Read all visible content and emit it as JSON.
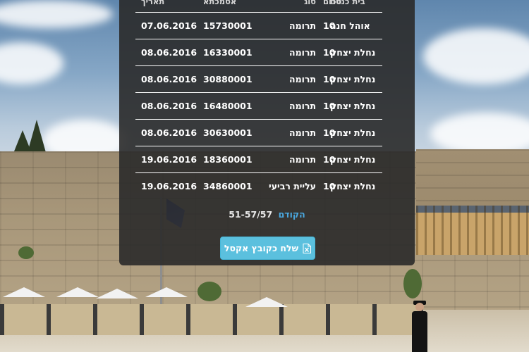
{
  "table": {
    "headers": {
      "date": "תאריך",
      "account": "אסמכתא",
      "type": "סוג",
      "amount": "סכום",
      "synagogue": "בית כנסת"
    },
    "rows": [
      {
        "date": "07.06.2016",
        "account": "15730001",
        "type": "תרומה",
        "amount": "10",
        "synagogue": "אוהל חנה"
      },
      {
        "date": "08.06.2016",
        "account": "16330001",
        "type": "תרומה",
        "amount": "10",
        "synagogue": "נחלת יצחק"
      },
      {
        "date": "08.06.2016",
        "account": "30880001",
        "type": "תרומה",
        "amount": "10",
        "synagogue": "נחלת יצחק"
      },
      {
        "date": "08.06.2016",
        "account": "16480001",
        "type": "תרומה",
        "amount": "10",
        "synagogue": "נחלת יצחק"
      },
      {
        "date": "08.06.2016",
        "account": "30630001",
        "type": "תרומה",
        "amount": "10",
        "synagogue": "נחלת יצחק"
      },
      {
        "date": "19.06.2016",
        "account": "18360001",
        "type": "תרומה",
        "amount": "10",
        "synagogue": "נחלת יצחק"
      },
      {
        "date": "19.06.2016",
        "account": "34860001",
        "type": "עליית רביעי",
        "amount": "10",
        "synagogue": "נחלת יצחק"
      }
    ]
  },
  "pager": {
    "range": "51-57/57",
    "prev_label": "הקודם"
  },
  "actions": {
    "excel_label": "שלח כקובץ אקסל",
    "excel_icon": "excel-file-icon"
  },
  "colors": {
    "link": "#4aa8e0",
    "button": "#5bc0de",
    "panel": "#2a2a2a"
  }
}
